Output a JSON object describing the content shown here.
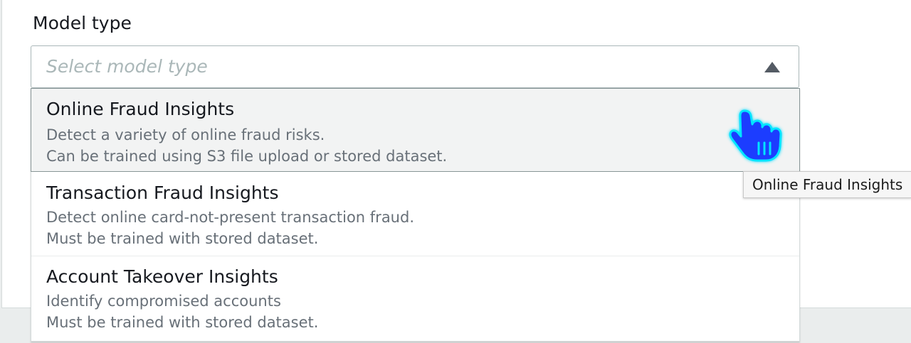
{
  "field": {
    "label": "Model type",
    "placeholder": "Select model type"
  },
  "options": [
    {
      "title": "Online Fraud Insights",
      "line1": "Detect a variety of online fraud risks.",
      "line2": "Can be trained using S3 file upload or stored dataset."
    },
    {
      "title": "Transaction Fraud Insights",
      "line1": "Detect online card-not-present transaction fraud.",
      "line2": "Must be trained with stored dataset."
    },
    {
      "title": "Account Takeover Insights",
      "line1": "Identify compromised accounts",
      "line2": "Must be trained with stored dataset."
    }
  ],
  "tooltip": {
    "text": "Online Fraud Insights"
  },
  "icons": {
    "caret": "caret-up-icon",
    "cursor": "hand-cursor-icon"
  },
  "colors": {
    "highlight_bg": "#f2f3f3",
    "cursor_fill": "#1a3cff",
    "cursor_glow": "#00e5ff"
  }
}
